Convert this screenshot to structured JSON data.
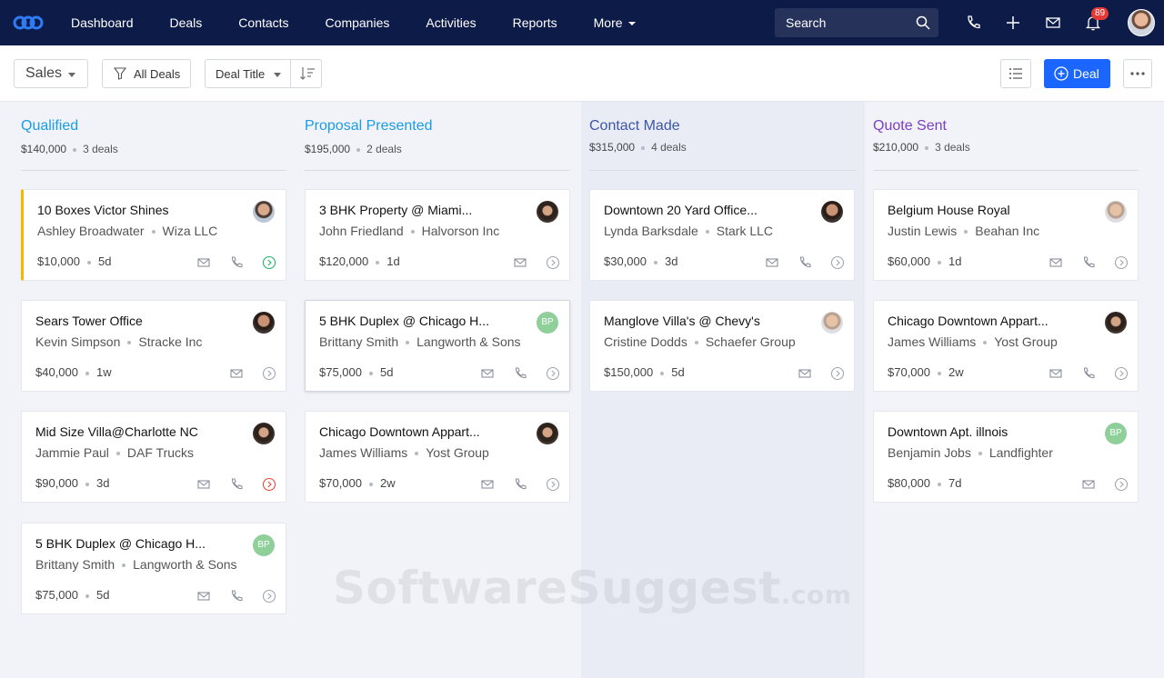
{
  "nav": {
    "items": [
      "Dashboard",
      "Deals",
      "Contacts",
      "Companies",
      "Activities",
      "Reports"
    ],
    "more_label": "More",
    "search_placeholder": "Search",
    "notification_count": "89"
  },
  "toolbar": {
    "pipeline_label": "Sales",
    "filter_label": "All Deals",
    "sort_label": "Deal Title",
    "add_deal_label": "Deal"
  },
  "columns": [
    {
      "title": "Qualified",
      "amount": "$140,000",
      "count": "3 deals",
      "color": "#1a9ce6",
      "cards": [
        {
          "title": "10 Boxes Victor Shines",
          "person": "Ashley Broadwater",
          "company": "Wiza LLC",
          "value": "$10,000",
          "age": "5d",
          "avatar": "av-a",
          "status": "green",
          "has_phone": true
        },
        {
          "title": "Sears Tower Office",
          "person": "Kevin Simpson",
          "company": "Stracke Inc",
          "value": "$40,000",
          "age": "1w",
          "avatar": "av-b",
          "status": "gray",
          "has_phone": false
        },
        {
          "title": "Mid Size Villa@Charlotte NC",
          "person": "Jammie Paul",
          "company": "DAF Trucks",
          "value": "$90,000",
          "age": "3d",
          "avatar": "av-d",
          "status": "red",
          "has_phone": true
        },
        {
          "title": "5 BHK Duplex @ Chicago H...",
          "person": "Brittany Smith",
          "company": "Langworth & Sons",
          "value": "$75,000",
          "age": "5d",
          "avatar": "bp",
          "initials": "BP",
          "status": "gray",
          "has_phone": true
        }
      ]
    },
    {
      "title": "Proposal Presented",
      "amount": "$195,000",
      "count": "2 deals",
      "color": "#1a9ce6",
      "cards": [
        {
          "title": "3 BHK Property @ Miami...",
          "person": "John Friedland",
          "company": "Halvorson Inc",
          "value": "$120,000",
          "age": "1d",
          "avatar": "av-d",
          "status": "gray",
          "has_phone": false
        },
        {
          "title": "5 BHK Duplex @ Chicago H...",
          "person": "Brittany Smith",
          "company": "Langworth & Sons",
          "value": "$75,000",
          "age": "5d",
          "avatar": "bp",
          "initials": "BP",
          "status": "gray",
          "has_phone": true
        },
        {
          "title": "Chicago Downtown Appart...",
          "person": "James Williams",
          "company": "Yost Group",
          "value": "$70,000",
          "age": "2w",
          "avatar": "av-d",
          "status": "gray",
          "has_phone": true
        }
      ]
    },
    {
      "title": "Contact Made",
      "amount": "$315,000",
      "count": "4 deals",
      "color": "#3d56a6",
      "cards": [
        {
          "title": "Downtown 20 Yard Office...",
          "person": "Lynda Barksdale",
          "company": "Stark LLC",
          "value": "$30,000",
          "age": "3d",
          "avatar": "av-b",
          "status": "gray",
          "has_phone": true
        },
        {
          "title": "Manglove Villa's @ Chevy's",
          "person": "Cristine Dodds",
          "company": "Schaefer Group",
          "value": "$150,000",
          "age": "5d",
          "avatar": "av-c",
          "status": "gray",
          "has_phone": false
        }
      ]
    },
    {
      "title": "Quote Sent",
      "amount": "$210,000",
      "count": "3 deals",
      "color": "#7a3fc4",
      "cards": [
        {
          "title": "Belgium House Royal",
          "person": "Justin Lewis",
          "company": "Beahan Inc",
          "value": "$60,000",
          "age": "1d",
          "avatar": "av-c",
          "status": "gray",
          "has_phone": true
        },
        {
          "title": "Chicago Downtown Appart...",
          "person": "James Williams",
          "company": "Yost Group",
          "value": "$70,000",
          "age": "2w",
          "avatar": "av-d",
          "status": "gray",
          "has_phone": true
        },
        {
          "title": "Downtown Apt. illnois",
          "person": "Benjamin Jobs",
          "company": "Landfighter",
          "value": "$80,000",
          "age": "7d",
          "avatar": "bp",
          "initials": "BP",
          "status": "gray",
          "has_phone": false
        }
      ]
    }
  ],
  "watermark": {
    "main": "SoftwareSuggest",
    "suffix": ".com"
  }
}
